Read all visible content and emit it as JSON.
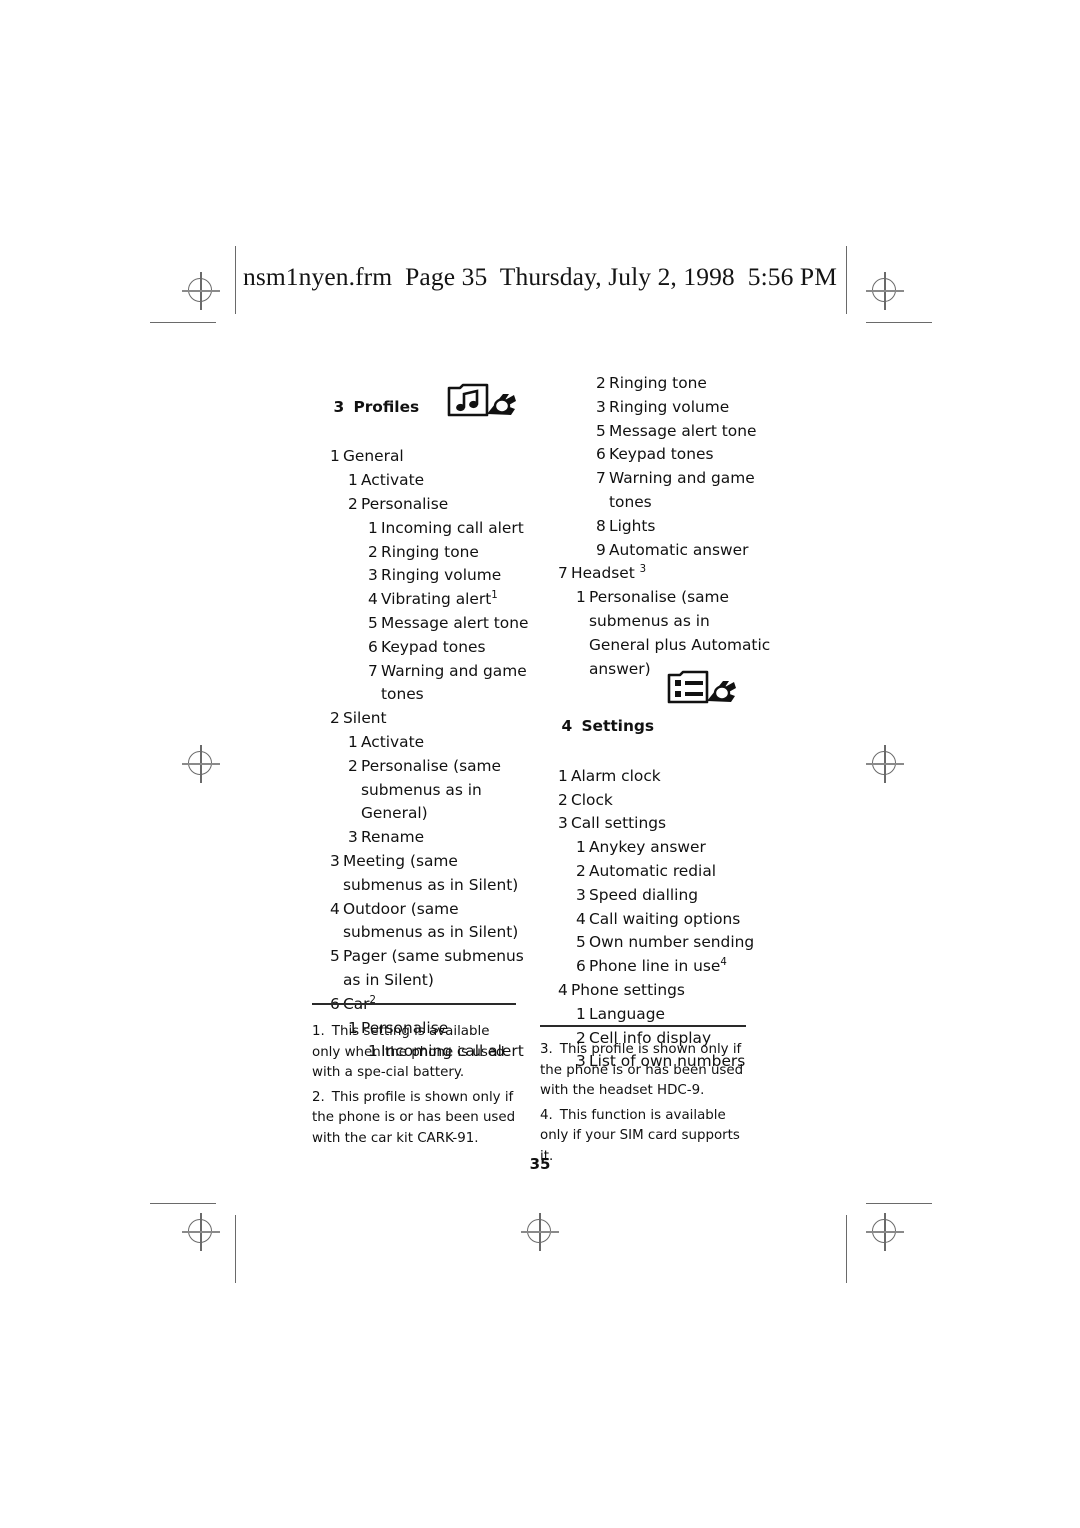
{
  "header": {
    "file_line": "nsm1nyen.frm  Page 35  Thursday, July 2, 1998  5:56 PM"
  },
  "page_number": "35",
  "left_column": {
    "section": {
      "number": "3",
      "title": "Profiles",
      "icon": "folder-music-note-icon"
    },
    "entries": [
      {
        "level": 1,
        "n": "1",
        "text": "General"
      },
      {
        "level": 2,
        "n": "1",
        "text": "Activate"
      },
      {
        "level": 2,
        "n": "2",
        "text": "Personalise"
      },
      {
        "level": 3,
        "n": "1",
        "text": "Incoming call alert"
      },
      {
        "level": 3,
        "n": "2",
        "text": "Ringing tone"
      },
      {
        "level": 3,
        "n": "3",
        "text": "Ringing volume"
      },
      {
        "level": 3,
        "n": "4",
        "text": "Vibrating alert",
        "sup": "1"
      },
      {
        "level": 3,
        "n": "5",
        "text": "Message alert tone"
      },
      {
        "level": 3,
        "n": "6",
        "text": "Keypad tones"
      },
      {
        "level": 3,
        "n": "7",
        "text": "Warning and game tones"
      },
      {
        "level": 1,
        "n": "2",
        "text": "Silent"
      },
      {
        "level": 2,
        "n": "1",
        "text": "Activate"
      },
      {
        "level": 2,
        "n": "2",
        "text": "Personalise (same submenus as in General)"
      },
      {
        "level": 2,
        "n": "3",
        "text": "Rename"
      },
      {
        "level": 1,
        "n": "3",
        "text": "Meeting (same submenus as in Silent)"
      },
      {
        "level": 1,
        "n": "4",
        "text": "Outdoor (same submenus as in Silent)"
      },
      {
        "level": 1,
        "n": "5",
        "text": "Pager (same submenus as in Silent)"
      },
      {
        "level": 1,
        "n": "6",
        "text": "Car",
        "sup": "2"
      },
      {
        "level": 2,
        "n": "1",
        "text": "Personalise"
      },
      {
        "level": 3,
        "n": "1",
        "text": "Incoming call alert"
      }
    ],
    "footnotes": [
      {
        "n": "1.",
        "text": "This setting is available only when the phone is used with a spe-cial battery."
      },
      {
        "n": "2.",
        "text": "This profile is shown only if the phone is or has been used with the car kit CARK-91."
      }
    ]
  },
  "right_column": {
    "continued_entries": [
      {
        "level": 3,
        "n": "2",
        "text": "Ringing tone"
      },
      {
        "level": 3,
        "n": "3",
        "text": "Ringing volume"
      },
      {
        "level": 3,
        "n": "5",
        "text": "Message alert tone"
      },
      {
        "level": 3,
        "n": "6",
        "text": "Keypad tones"
      },
      {
        "level": 3,
        "n": "7",
        "text": "Warning and game tones"
      },
      {
        "level": 3,
        "n": "8",
        "text": "Lights"
      },
      {
        "level": 3,
        "n": "9",
        "text": "Automatic answer"
      },
      {
        "level": 1,
        "n": "7",
        "text": "Headset ",
        "sup": "3"
      },
      {
        "level": 2,
        "n": "1",
        "text": "Personalise (same submenus as in General plus Automatic answer)"
      }
    ],
    "section": {
      "number": "4",
      "title": "Settings",
      "icon": "settings-list-card-icon"
    },
    "entries": [
      {
        "level": 1,
        "n": "1",
        "text": "Alarm clock"
      },
      {
        "level": 1,
        "n": "2",
        "text": "Clock"
      },
      {
        "level": 1,
        "n": "3",
        "text": "Call settings"
      },
      {
        "level": 2,
        "n": "1",
        "text": "Anykey answer"
      },
      {
        "level": 2,
        "n": "2",
        "text": "Automatic redial"
      },
      {
        "level": 2,
        "n": "3",
        "text": "Speed dialling"
      },
      {
        "level": 2,
        "n": "4",
        "text": "Call waiting options"
      },
      {
        "level": 2,
        "n": "5",
        "text": "Own number sending"
      },
      {
        "level": 2,
        "n": "6",
        "text": "Phone line in use",
        "sup": "4"
      },
      {
        "level": 1,
        "n": "4",
        "text": "Phone settings"
      },
      {
        "level": 2,
        "n": "1",
        "text": "Language"
      },
      {
        "level": 2,
        "n": "2",
        "text": "Cell info display"
      },
      {
        "level": 2,
        "n": "3",
        "text": "List of own numbers"
      }
    ],
    "footnotes": [
      {
        "n": "3.",
        "text": "This profile is shown only if the phone is or has been used with the headset HDC-9."
      },
      {
        "n": "4.",
        "text": "This function is available only if your SIM card supports it."
      }
    ]
  },
  "colors": {
    "ink": "#111111",
    "regmark": "#6a6a6a",
    "paper": "#ffffff"
  }
}
